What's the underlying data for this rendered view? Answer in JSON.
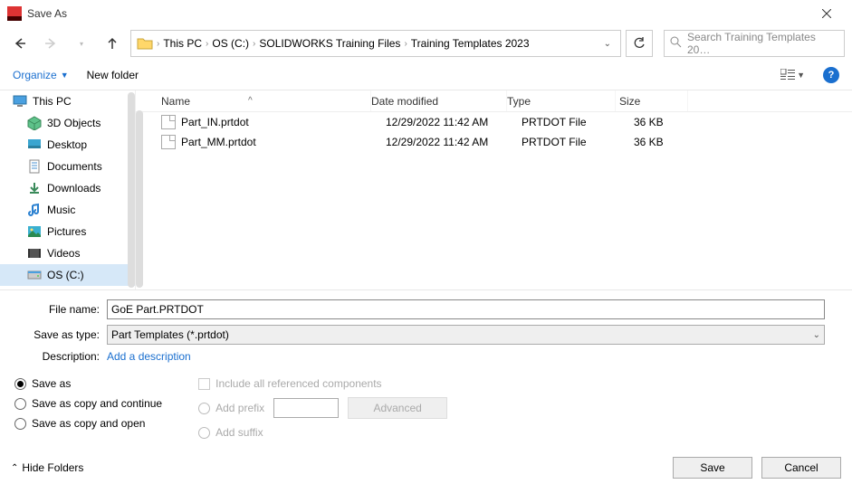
{
  "window": {
    "title": "Save As"
  },
  "nav": {
    "crumbs": [
      "This PC",
      "OS (C:)",
      "SOLIDWORKS Training Files",
      "Training Templates 2023"
    ],
    "search_placeholder": "Search Training Templates 20…"
  },
  "toolbar": {
    "organize": "Organize",
    "new_folder": "New folder"
  },
  "sidebar": {
    "items": [
      {
        "icon": "monitor-icon",
        "label": "This PC",
        "sub": false,
        "sel": false
      },
      {
        "icon": "cube-icon",
        "label": "3D Objects",
        "sub": true,
        "sel": false
      },
      {
        "icon": "desktop-icon",
        "label": "Desktop",
        "sub": true,
        "sel": false
      },
      {
        "icon": "doc-icon",
        "label": "Documents",
        "sub": true,
        "sel": false
      },
      {
        "icon": "download-icon",
        "label": "Downloads",
        "sub": true,
        "sel": false
      },
      {
        "icon": "music-icon",
        "label": "Music",
        "sub": true,
        "sel": false
      },
      {
        "icon": "picture-icon",
        "label": "Pictures",
        "sub": true,
        "sel": false
      },
      {
        "icon": "video-icon",
        "label": "Videos",
        "sub": true,
        "sel": false
      },
      {
        "icon": "disk-icon",
        "label": "OS (C:)",
        "sub": true,
        "sel": true
      }
    ]
  },
  "columns": {
    "name": "Name",
    "date": "Date modified",
    "type": "Type",
    "size": "Size"
  },
  "files": [
    {
      "name": "Part_IN.prtdot",
      "date": "12/29/2022 11:42 AM",
      "type": "PRTDOT File",
      "size": "36 KB"
    },
    {
      "name": "Part_MM.prtdot",
      "date": "12/29/2022 11:42 AM",
      "type": "PRTDOT File",
      "size": "36 KB"
    }
  ],
  "form": {
    "file_name_label": "File name:",
    "file_name_value": "GoE Part.PRTDOT",
    "save_type_label": "Save as type:",
    "save_type_value": "Part Templates (*.prtdot)",
    "description_label": "Description:",
    "description_link": "Add a description"
  },
  "save_opts": {
    "r1": "Save as",
    "r2": "Save as copy and continue",
    "r3": "Save as copy and open",
    "include": "Include all referenced components",
    "prefix": "Add prefix",
    "suffix": "Add suffix",
    "advanced": "Advanced"
  },
  "footer": {
    "hide": "Hide Folders",
    "save": "Save",
    "cancel": "Cancel"
  }
}
